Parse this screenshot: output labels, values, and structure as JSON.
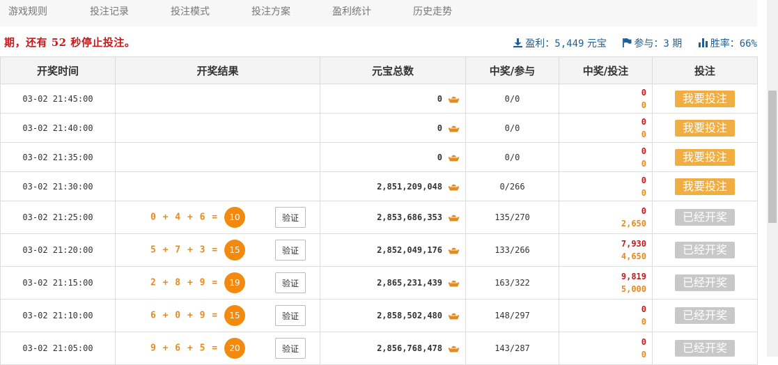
{
  "nav": {
    "tabs": [
      "游戏规则",
      "投注记录",
      "投注模式",
      "投注方案",
      "盈利统计",
      "历史走势"
    ]
  },
  "status": {
    "countdown": "期，还有 52 秒停止投注。",
    "profit_label": "盈利：",
    "profit_value": "5,449",
    "profit_unit": " 元宝",
    "participate_label": "参与：",
    "participate_value": "3",
    "participate_unit": " 期",
    "winrate_label": "胜率：",
    "winrate_value": "66%"
  },
  "table": {
    "headers": [
      "开奖时间",
      "开奖结果",
      "元宝总数",
      "中奖/参与",
      "中奖/投注",
      "投注"
    ],
    "verify_label": "验证",
    "rows": [
      {
        "time": "03-02 21:45:00",
        "formula": "",
        "sum": "",
        "total": "0",
        "ratio": "0/0",
        "win": "0",
        "bet": "0",
        "action": "我要投注",
        "state": "active"
      },
      {
        "time": "03-02 21:40:00",
        "formula": "",
        "sum": "",
        "total": "0",
        "ratio": "0/0",
        "win": "0",
        "bet": "0",
        "action": "我要投注",
        "state": "active"
      },
      {
        "time": "03-02 21:35:00",
        "formula": "",
        "sum": "",
        "total": "0",
        "ratio": "0/0",
        "win": "0",
        "bet": "0",
        "action": "我要投注",
        "state": "active"
      },
      {
        "time": "03-02 21:30:00",
        "formula": "",
        "sum": "",
        "total": "2,851,209,048",
        "ratio": "0/266",
        "win": "0",
        "bet": "0",
        "action": "我要投注",
        "state": "active"
      },
      {
        "time": "03-02 21:25:00",
        "formula": "0 + 4 + 6 =",
        "sum": "10",
        "total": "2,853,686,353",
        "ratio": "135/270",
        "win": "0",
        "bet": "2,650",
        "action": "已经开奖",
        "state": "done"
      },
      {
        "time": "03-02 21:20:00",
        "formula": "5 + 7 + 3 =",
        "sum": "15",
        "total": "2,852,049,176",
        "ratio": "133/266",
        "win": "7,930",
        "bet": "4,650",
        "action": "已经开奖",
        "state": "done"
      },
      {
        "time": "03-02 21:15:00",
        "formula": "2 + 8 + 9 =",
        "sum": "19",
        "total": "2,865,231,439",
        "ratio": "163/322",
        "win": "9,819",
        "bet": "5,000",
        "action": "已经开奖",
        "state": "done"
      },
      {
        "time": "03-02 21:10:00",
        "formula": "6 + 0 + 9 =",
        "sum": "15",
        "total": "2,858,502,480",
        "ratio": "148/297",
        "win": "0",
        "bet": "0",
        "action": "已经开奖",
        "state": "done"
      },
      {
        "time": "03-02 21:05:00",
        "formula": "9 + 6 + 5 =",
        "sum": "20",
        "total": "2,856,768,478",
        "ratio": "143/287",
        "win": "0",
        "bet": "0",
        "action": "已经开奖",
        "state": "done"
      }
    ]
  },
  "colors": {
    "accent_orange": "#f18a0e",
    "win_red": "#c9181a",
    "link_blue": "#1f5f96",
    "button_active": "#f0ad42",
    "button_done": "#c8c8c8"
  },
  "icons": {
    "profit": "download-icon",
    "participate": "flag-icon",
    "winrate": "bar-chart-icon",
    "currency": "ingot-icon"
  }
}
